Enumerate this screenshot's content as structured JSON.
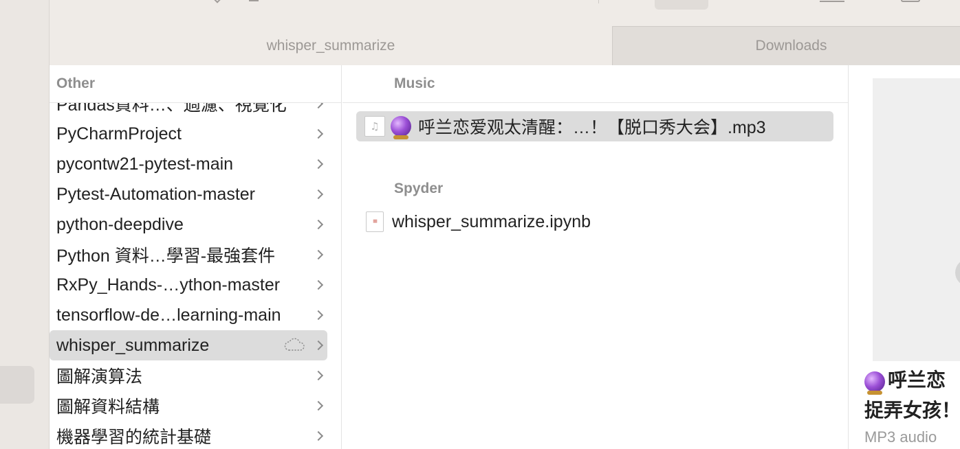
{
  "tabs": [
    {
      "label": "whisper_summarize",
      "active": true
    },
    {
      "label": "Downloads",
      "active": false
    }
  ],
  "column1": {
    "header": "Other",
    "items": [
      {
        "label": "Pandas資料…、過濾、視覺化",
        "selected": false,
        "cloud": false
      },
      {
        "label": "PyCharmProject",
        "selected": false,
        "cloud": false
      },
      {
        "label": "pycontw21-pytest-main",
        "selected": false,
        "cloud": false
      },
      {
        "label": "Pytest-Automation-master",
        "selected": false,
        "cloud": false
      },
      {
        "label": "python-deepdive",
        "selected": false,
        "cloud": false
      },
      {
        "label": "Python 資料…學習-最強套件",
        "selected": false,
        "cloud": false
      },
      {
        "label": "RxPy_Hands-…ython-master",
        "selected": false,
        "cloud": false
      },
      {
        "label": "tensorflow-de…learning-main",
        "selected": false,
        "cloud": false
      },
      {
        "label": "whisper_summarize",
        "selected": true,
        "cloud": true
      },
      {
        "label": "圖解演算法",
        "selected": false,
        "cloud": false
      },
      {
        "label": "圖解資料結構",
        "selected": false,
        "cloud": false
      },
      {
        "label": "機器學習的統計基礎",
        "selected": false,
        "cloud": false
      }
    ]
  },
  "column2": {
    "header": "Music",
    "music_file": "呼兰恋爱观太清醒：…！【脱口秀大会】.mp3",
    "group_label": "Spyder",
    "notebook_file": "whisper_summarize.ipynb"
  },
  "preview": {
    "title_line1": "呼兰恋",
    "title_line2": "捉弄女孩！",
    "subtitle": "MP3 audio"
  },
  "icons": {
    "folder_chevron": "chevron-right-icon",
    "cloud": "cloud-download-icon",
    "music_doc": "music-file-icon",
    "notebook_doc": "notebook-file-icon",
    "crystal_ball": "crystal-ball-emoji"
  },
  "colors": {
    "selection": "#dcdcdc",
    "sidebar_bg": "#efebe7",
    "inactive_tab_bg": "#e1ddd9"
  }
}
